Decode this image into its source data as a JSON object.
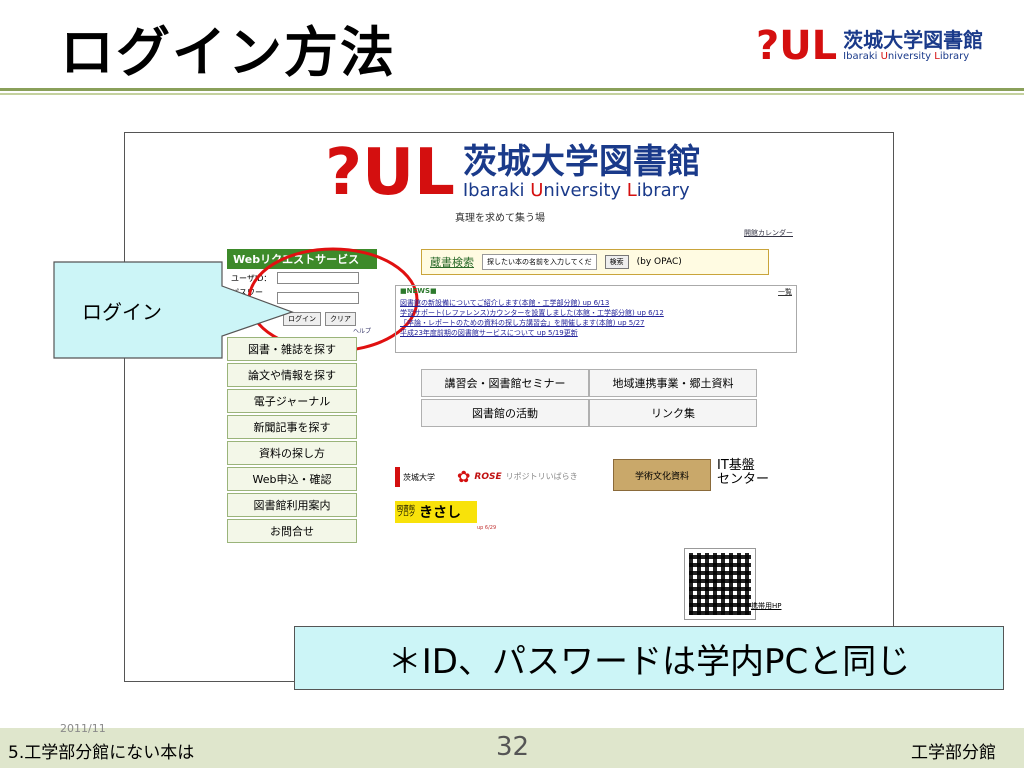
{
  "slide": {
    "title": "ログイン方法",
    "note": "＊ID、パスワードは学内PCと同じ",
    "callout": "ログイン"
  },
  "logo": {
    "mark": "?UL",
    "kanji": "茨城大学図書館",
    "english_a": "Ibaraki ",
    "english_b": "U",
    "english_c": "niversity ",
    "english_d": "L",
    "english_e": "ibrary"
  },
  "screenshot": {
    "tagline": "真理を求めて集う場",
    "calendar_link": "開館カレンダー",
    "web_request": {
      "title": "Webリクエストサービス",
      "user_id_label": "ユーザID：",
      "password_label": "パスワード：",
      "login_button": "ログイン",
      "clear_button": "クリア",
      "help": "ヘルプ"
    },
    "search": {
      "label": "蔵書検索",
      "placeholder": "探したい本の名前を入力してくだ",
      "button": "検索",
      "suffix": "(by OPAC)"
    },
    "news": {
      "title": "■NEWS■",
      "list_link": "一覧",
      "items": [
        "図書館の新設備についてご紹介します(本館・工学部分館) up 6/13",
        "学習サポート(レファレンス)カウンターを設置しました(本館・工学部分館) up 6/12",
        "「卒論・レポートのための資料の探し方講習会」を開催します(本館) up 5/27",
        "平成23年度前期の図書館サービスについて up 5/19更新"
      ]
    },
    "menu": [
      "図書・雑誌を探す",
      "論文や情報を探す",
      "電子ジャーナル",
      "新聞記事を探す",
      "資料の探し方",
      "Web申込・確認",
      "図書館利用案内",
      "お問合せ"
    ],
    "grid": [
      "講習会・図書館セミナー",
      "地域連携事業・郷土資料",
      "図書館の活動",
      "リンク集"
    ],
    "links": {
      "univ": "茨城大学",
      "rose": "ROSE",
      "repository": "リポジトリいばらき",
      "archive": "学術文化資料",
      "it1": "IT基盤",
      "it2": "センター",
      "blog1": "図書館",
      "blog2": "ブログ",
      "kisashi": "きさし",
      "blog_date": "up 6/29",
      "mobile": "携帯用HP"
    }
  },
  "footer": {
    "left": "5.工学部分館にない本は",
    "date": "2011/11",
    "page": "32",
    "right": "工学部分館"
  },
  "colors": {
    "brand_red": "#d40f0f",
    "brand_blue": "#1a3a8a",
    "callout_fill": "#ccf5f7",
    "footer_bg": "#dfe6cc",
    "highlight_circle": "#e01010"
  }
}
